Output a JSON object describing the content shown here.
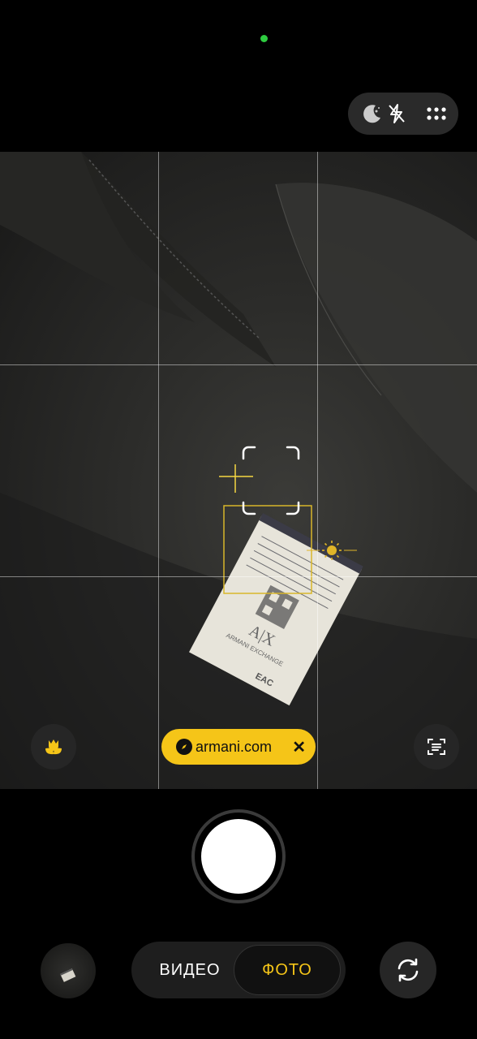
{
  "status": {
    "privacy_indicator": "camera-in-use",
    "indicator_color": "#2ecc40"
  },
  "top_controls": {
    "night_mode_icon": "moon-icon",
    "flash_icon": "flash-off-icon",
    "more_icon": "grid-dots-icon"
  },
  "viewfinder": {
    "label_text": {
      "brand": "A|X",
      "brand_name": "ARMANI EXCHANGE",
      "eac": "EAC"
    }
  },
  "scene_optimizer_icon": "flower-icon",
  "link_chip": {
    "text": "armani.com",
    "icon": "compass-icon",
    "close_glyph": "✕",
    "color": "#f5c518"
  },
  "scan_text_icon": "text-scan-icon",
  "modes": {
    "video": "ВИДЕО",
    "photo": "ФОТО",
    "active": "photo",
    "active_color": "#f5c518"
  },
  "switch_camera_icon": "rotate-camera-icon",
  "gallery_thumbnail": "last-photo-thumbnail"
}
